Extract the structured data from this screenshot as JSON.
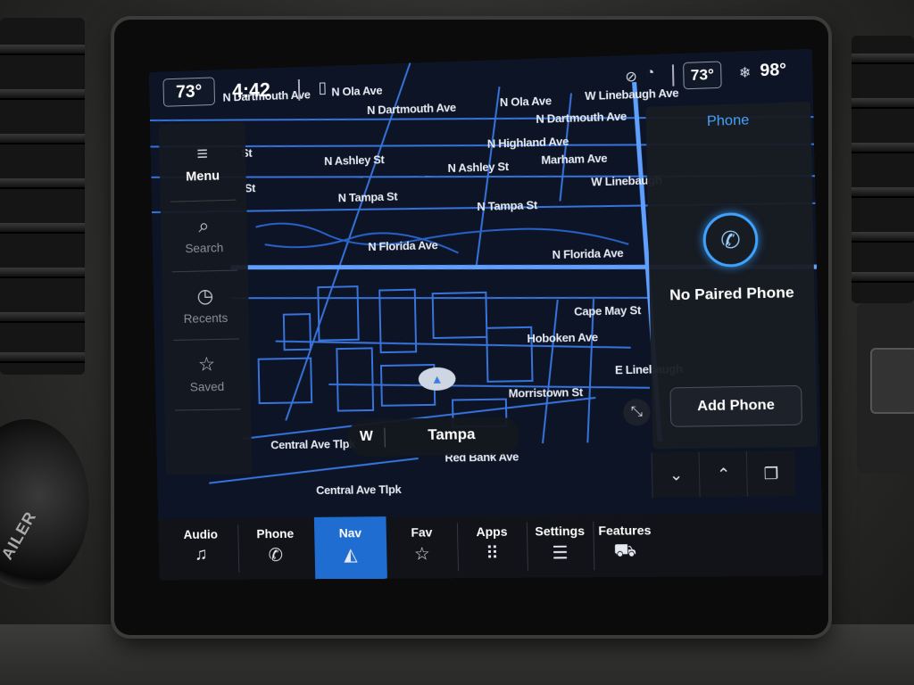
{
  "status_bar": {
    "outside_temp": "73°",
    "clock": "4:42",
    "cabin_temp": "73°",
    "right_temp": "98°"
  },
  "map": {
    "streets": [
      "N Dartmouth Ave",
      "N Dartmouth Ave",
      "N Ola Ave",
      "N Ola Ave",
      "W Linebaugh Ave",
      "N Dartmouth Ave",
      "N Highland Ave",
      "N Ashley St",
      "N Ashley St",
      "Marham Ave",
      "W Linebaugh",
      "N Tampa St",
      "N Tampa St",
      "N Florida Ave",
      "N Florida Ave",
      "Cape May St",
      "Hoboken Ave",
      "E Linebaugh",
      "Morristown St",
      "Central Ave Tlpk",
      "Red Bank Ave",
      "Central Ave Tlpk",
      "St",
      "St"
    ]
  },
  "menu": {
    "items": [
      {
        "label": "Menu",
        "icon": "≡"
      },
      {
        "label": "Search",
        "icon": "⌕"
      },
      {
        "label": "Recents",
        "icon": "◷"
      },
      {
        "label": "Saved",
        "icon": "☆"
      }
    ]
  },
  "phone_panel": {
    "title": "Phone",
    "status": "No Paired Phone",
    "add_button": "Add Phone"
  },
  "nav_pill": {
    "heading": "W",
    "city": "Tampa"
  },
  "bottom_tabs": [
    {
      "label": "Audio",
      "icon": "♫"
    },
    {
      "label": "Phone",
      "icon": "✆"
    },
    {
      "label": "Nav",
      "icon": "◭"
    },
    {
      "label": "Fav",
      "icon": "☆"
    },
    {
      "label": "Apps",
      "icon": "⠿"
    },
    {
      "label": "Settings",
      "icon": "☰"
    },
    {
      "label": "Features",
      "icon": "⛟"
    }
  ],
  "controls": {
    "down": "⌄",
    "up": "⌃",
    "copy": "❐",
    "expand": "⤡"
  },
  "dash": {
    "knob_label": "AILER"
  }
}
